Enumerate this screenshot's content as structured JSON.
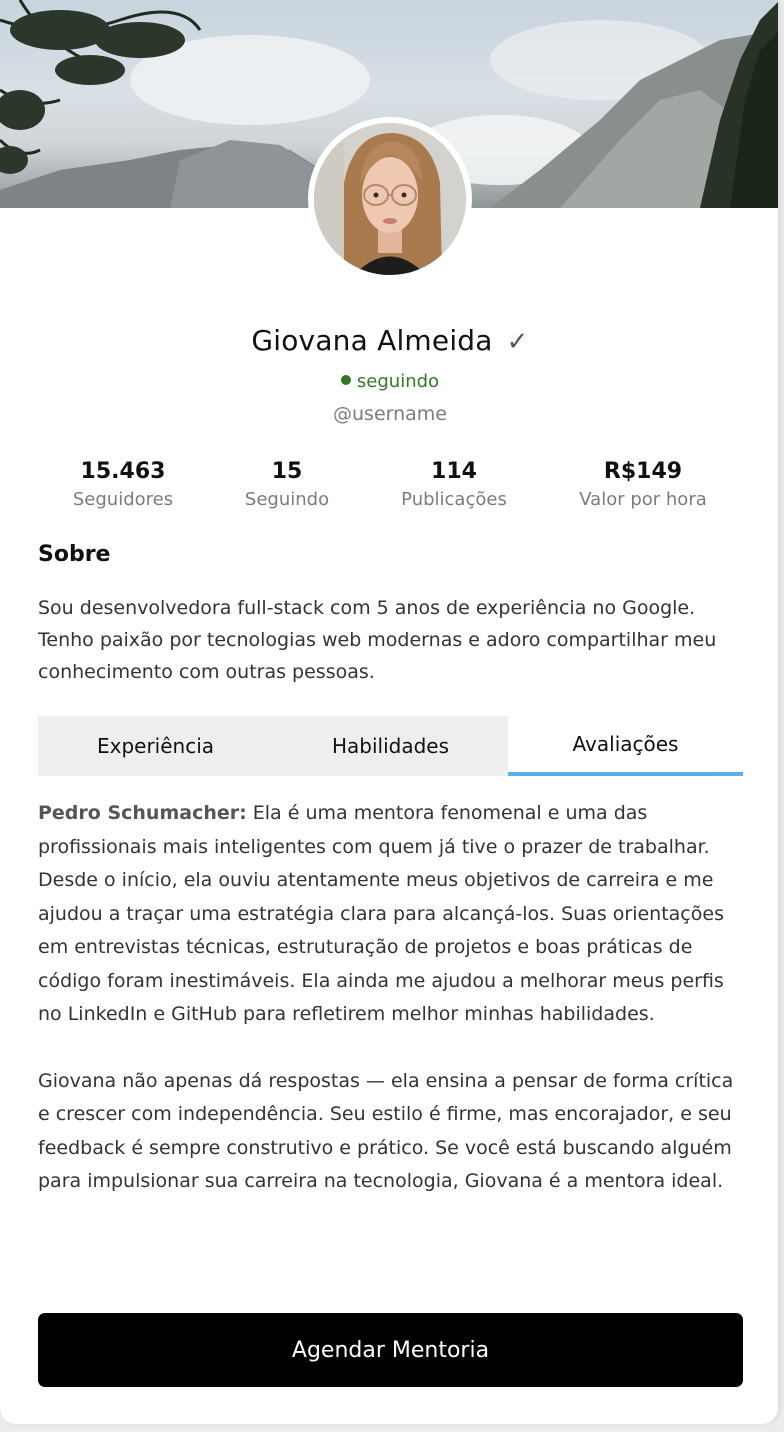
{
  "profile": {
    "name": "Giovana Almeida",
    "status": "seguindo",
    "username": "@username"
  },
  "stats": [
    {
      "value": "15.463",
      "label": "Seguidores"
    },
    {
      "value": "15",
      "label": "Seguindo"
    },
    {
      "value": "114",
      "label": "Publicações"
    },
    {
      "value": "R$149",
      "label": "Valor por hora"
    }
  ],
  "about": {
    "title": "Sobre",
    "text": "Sou desenvolvedora full-stack com 5 anos de experiência no Google. Tenho paixão por tecnologias web modernas e adoro compartilhar meu conhecimento com outras pessoas."
  },
  "tabs": [
    {
      "label": "Experiência",
      "active": false
    },
    {
      "label": "Habilidades",
      "active": false
    },
    {
      "label": "Avaliações",
      "active": true
    }
  ],
  "review": {
    "author": "Pedro Schumacher:",
    "paragraph1": "Ela é uma mentora fenomenal e uma das profissionais mais inteligentes com quem já tive o prazer de trabalhar. Desde o início, ela ouviu atentamente meus objetivos de carreira e me ajudou a traçar uma estratégia clara para alcançá-los. Suas orientações em entrevistas técnicas, estruturação de projetos e boas práticas de código foram inestimáveis. Ela ainda me ajudou a melhorar meus perfis no LinkedIn e GitHub para refletirem melhor minhas habilidades.",
    "paragraph2": "Giovana não apenas dá respostas — ela ensina a pensar de forma crítica e crescer com independência. Seu estilo é firme, mas encorajador, e seu feedback é sempre construtivo e prático. Se você está buscando alguém para impulsionar sua carreira na tecnologia, Giovana é a mentora ideal."
  },
  "cta": {
    "label": "Agendar Mentoria"
  },
  "colors": {
    "status_green": "#2f7a22",
    "tab_active_underline": "#58b0e4",
    "button_bg": "#000000"
  }
}
